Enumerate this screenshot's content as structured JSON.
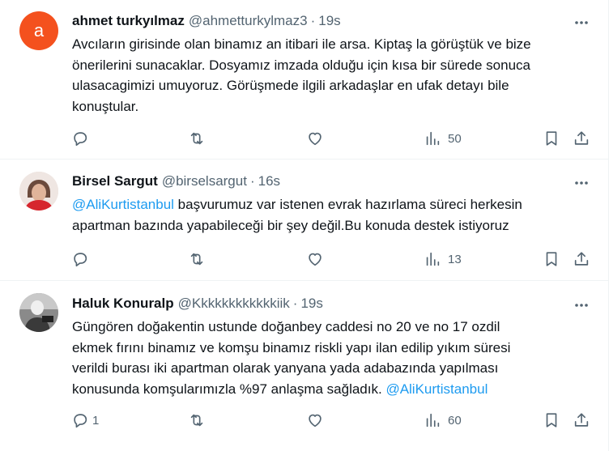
{
  "tweets": [
    {
      "avatar_letter": "a",
      "name": "ahmet turkyılmaz",
      "handle": "@ahmetturkylmaz3",
      "time": "19s",
      "text_lines": [
        "Avcıların girisinde olan binamız an itibari ile arsa. Kiptaş la görüştük ve bize",
        "önerilerini sunacaklar. Dosyamız imzada olduğu için kısa bir sürede sonuca",
        "ulasacagimizi umuyoruz. Görüşmede ilgili arkadaşlar en ufak detayı bile",
        "konuştular."
      ],
      "replies": "",
      "retweets": "",
      "likes": "",
      "views": "50"
    },
    {
      "name": "Birsel Sargut",
      "handle": "@birselsargut",
      "time": "16s",
      "mention": "@AliKurtistanbul",
      "text_line1_rest": " başvurumuz var istenen evrak hazırlama süreci herkesin",
      "text_line2": "apartman bazında yapabileceği bir şey değil.Bu konuda destek istiyoruz",
      "replies": "",
      "retweets": "",
      "likes": "",
      "views": "13"
    },
    {
      "name": "Haluk Konuralp",
      "handle": "@Kkkkkkkkkkkkiik",
      "time": "19s",
      "text_lines": [
        "Güngören doğakentin ustunde doğanbey caddesi no 20 ve no 17  ozdil",
        "ekmek fırını binamız ve komşu binamız riskli yapı ilan edilip yıkım süresi",
        "verildi burası iki apartman olarak yanyana yada adabazında yapılması"
      ],
      "text_last_line": "konusunda komşularımızla %97 anlaşma sağladık. ",
      "mention": "@AliKurtistanbul",
      "replies": "1",
      "retweets": "",
      "likes": "",
      "views": "60"
    }
  ],
  "separator": "·"
}
